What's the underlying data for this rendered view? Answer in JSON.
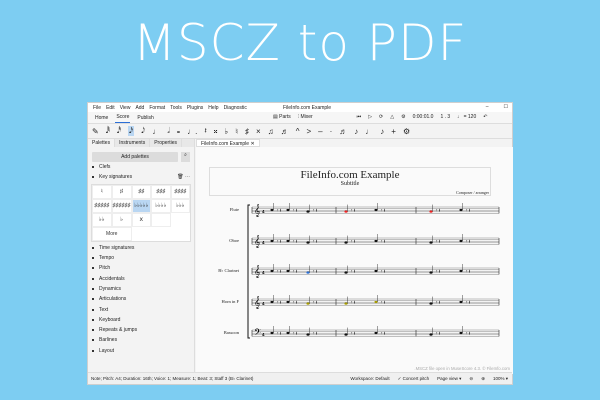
{
  "headline": "MSCZ to PDF",
  "window": {
    "title": "FileInfo.com Example",
    "menu": [
      "File",
      "Edit",
      "View",
      "Add",
      "Format",
      "Tools",
      "Plugins",
      "Help",
      "Diagnostic"
    ],
    "tabs": [
      "Home",
      "Score",
      "Publish"
    ],
    "active_tab": "Score",
    "parts": "Parts",
    "mixer": "Mixer",
    "time": "0:00:01.0",
    "position": "1 . 3",
    "tempo": "♩ = 120",
    "toolbar": [
      "✎",
      "𝅘𝅥𝅱",
      "𝅘𝅥𝅰",
      "𝅘𝅥𝅯",
      "𝅘𝅥𝅮",
      "♩",
      "𝅗𝅥",
      "𝅝",
      "♩.",
      "𝄽",
      "𝄪",
      "♭",
      "♮",
      "♯",
      "×",
      "♫",
      "♬",
      "^",
      ">",
      "–",
      "·",
      "♬",
      "♪",
      "♩",
      "♪",
      "+",
      "⚙"
    ],
    "toolbar_selected": 3
  },
  "palette": {
    "tabs": [
      "Palettes",
      "Instruments",
      "Properties"
    ],
    "add_palettes": "Add palettes",
    "clefs": "Clefs",
    "key_signatures": "Key signatures",
    "keys": [
      "♮",
      "♯",
      "♯♯",
      "♯♯♯",
      "♯♯♯♯",
      "♯♯♯♯♯",
      "♯♯♯♯♯♯",
      "♭♭♭♭♭",
      "♭♭♭♭",
      "♭♭♭",
      "♭♭",
      "♭",
      "ⅹ",
      ""
    ],
    "key_selected": 7,
    "more": "More",
    "items": [
      "Time signatures",
      "Tempo",
      "Pitch",
      "Accidentals",
      "Dynamics",
      "Articulations",
      "Text",
      "Keyboard",
      "Repeats & jumps",
      "Barlines",
      "Layout"
    ]
  },
  "document": {
    "tab": "FileInfo.com Example",
    "title": "FileInfo.com Example",
    "subtitle": "Subtitle",
    "composer": "Composer / arranger",
    "instruments": [
      "Flute",
      "Oboe",
      "B♭ Clarinet",
      "Horn in F",
      "Bassoon"
    ],
    "watermark": ".MSCZ file open in MuseScore 4.3. © FileInfo.com"
  },
  "status": {
    "note": "Note; Pitch: A4; Duration: 16th; Voice: 1; Measure: 1; Beat: 3; Staff 3 (B♭ Clarinet)",
    "workspace": "Workspace: Default",
    "concert": "Concert pitch",
    "view": "Page view ▾",
    "zoom": "100%  ▾"
  }
}
